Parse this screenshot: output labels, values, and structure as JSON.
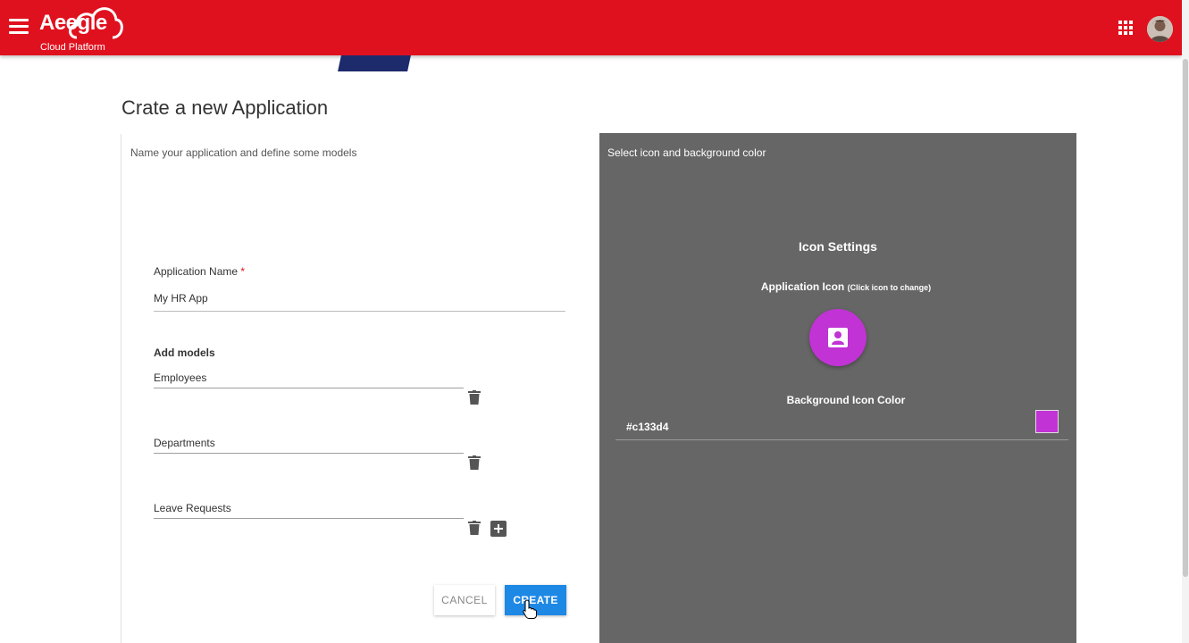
{
  "app": {
    "logo_text": "Aeegle",
    "logo_sub": "Cloud Platform"
  },
  "page": {
    "title": "Crate a new Application"
  },
  "left": {
    "subtitle": "Name your application and define some models",
    "app_name_label": "Application Name",
    "required_marker": "*",
    "app_name_value": "My HR App",
    "models_label": "Add models",
    "models": [
      {
        "value": "Employees"
      },
      {
        "value": "Departments"
      },
      {
        "value": "Leave Requests"
      }
    ],
    "cancel_label": "CANCEL",
    "create_label": "CREATE"
  },
  "right": {
    "subtitle": "Select icon and background color",
    "icon_settings_title": "Icon Settings",
    "app_icon_label": "Application Icon",
    "app_icon_hint": "(Click icon to change)",
    "bg_color_label": "Background Icon Color",
    "bg_color_value": "#c133d4"
  },
  "colors": {
    "topbar": "#e0111f",
    "accent": "#1e88e5",
    "icon_bg": "#c133d4",
    "panel": "#666666"
  },
  "icons": {
    "menu": "menu-icon",
    "apps": "apps-grid-icon",
    "app_icon": "contact-card-icon",
    "delete": "trash-icon",
    "add": "add-box-icon"
  }
}
